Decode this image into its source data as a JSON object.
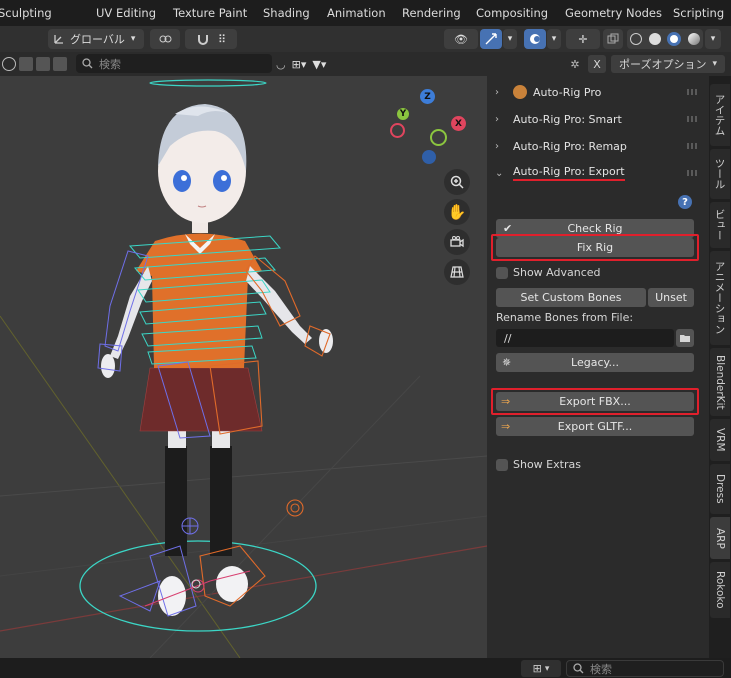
{
  "workspace_tabs": [
    "Sculpting",
    "UV Editing",
    "Texture Paint",
    "Shading",
    "Animation",
    "Rendering",
    "Compositing",
    "Geometry Nodes",
    "Scripting"
  ],
  "header": {
    "orientation_label": "グローバル"
  },
  "toolrow": {
    "search_placeholder": "検索",
    "pose_options_label": "ポーズオプション"
  },
  "sidebar": {
    "panels": [
      {
        "label": "Auto-Rig Pro",
        "expanded": false
      },
      {
        "label": "Auto-Rig Pro: Smart",
        "expanded": false
      },
      {
        "label": "Auto-Rig Pro: Remap",
        "expanded": false
      },
      {
        "label": "Auto-Rig Pro: Export",
        "expanded": true
      }
    ],
    "export": {
      "check_rig": "Check Rig",
      "fix_rig": "Fix Rig",
      "show_advanced": "Show Advanced",
      "set_custom_bones": "Set Custom Bones",
      "unset": "Unset",
      "rename_bones_label": "Rename Bones from File:",
      "rename_path_value": "//",
      "legacy": "Legacy...",
      "export_fbx": "Export FBX...",
      "export_gltf": "Export GLTF...",
      "show_extras": "Show Extras"
    }
  },
  "vertical_tabs": [
    "アイテム",
    "ツール",
    "ビュー",
    "アニメーション",
    "BlenderKit",
    "VRM",
    "Dress",
    "ARP",
    "Rokoko"
  ],
  "gizmo": {
    "z": "Z",
    "y": "Y",
    "x": "X"
  },
  "status": {
    "search_placeholder": "検索"
  },
  "colors": {
    "highlight_red": "#e0202c",
    "active_blue": "#4772b3",
    "axis_x": "#e0455e",
    "axis_y": "#8bc53f",
    "axis_z": "#3d7dd8"
  }
}
